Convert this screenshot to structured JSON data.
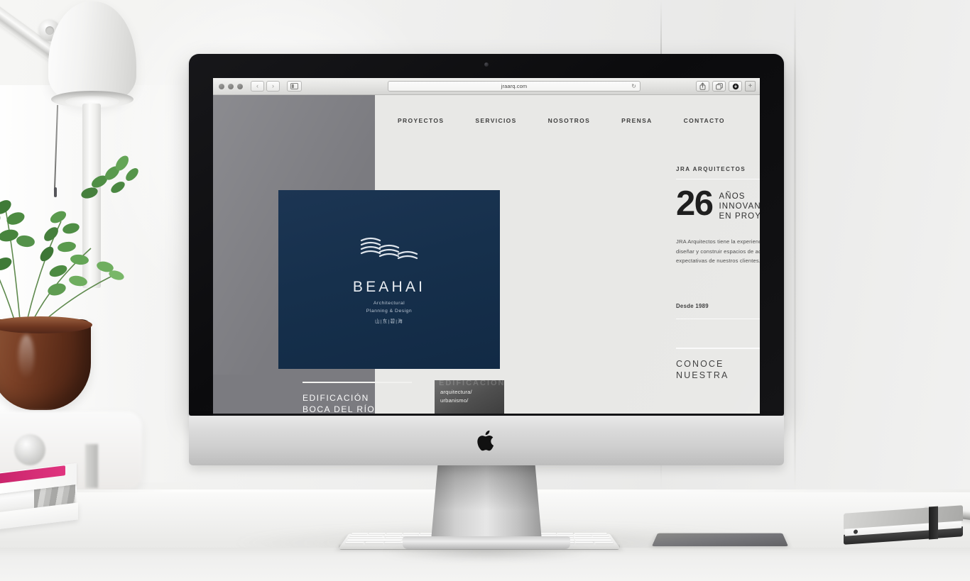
{
  "scene": {
    "description": "Desktop workspace with iMac displaying a website",
    "objects": {
      "lamp": "desk-lamp",
      "plant": "potted-plant",
      "books": "stacked-magazines",
      "notebook": "notebook",
      "pen": "pen",
      "keyboard": "apple-magic-keyboard",
      "trackpad": "apple-magic-trackpad"
    }
  },
  "browser": {
    "traffic_lights": [
      "close",
      "minimize",
      "zoom"
    ],
    "back_label": "‹",
    "forward_label": "›",
    "sidebar_icon": "sidebar-icon",
    "url": "jraarq.com",
    "reload_label": "↻",
    "tools": [
      {
        "name": "share-icon",
        "glyph": "⇧"
      },
      {
        "name": "tabs-icon",
        "glyph": "⧉"
      },
      {
        "name": "downloads-icon",
        "glyph": "●"
      }
    ],
    "new_tab_label": "+"
  },
  "site": {
    "nav": [
      {
        "label": "PROYECTOS",
        "name": "nav-proyectos"
      },
      {
        "label": "SERVICIOS",
        "name": "nav-servicios"
      },
      {
        "label": "NOSOTROS",
        "name": "nav-nosotros"
      },
      {
        "label": "PRENSA",
        "name": "nav-prensa"
      },
      {
        "label": "CONTACTO",
        "name": "nav-contacto"
      }
    ],
    "hero": {
      "brand": "BEAHAI",
      "tagline_line1": "Architectural",
      "tagline_line2": "Planning & Design",
      "chinese": "山|东|碧|海",
      "panel_color": "#16304c"
    },
    "content": {
      "kicker": "JRA ARQUITECTOS",
      "big_number": "26",
      "big_text_line1": "AÑOS",
      "big_text_line2": "INNOVANDO",
      "big_text_line3": "EN PROYECTOS",
      "paragraph": "JRA Arquitectos tiene la experiencia y el conocimiento de para diseñar y construir espacios de acuerdo a las necesidades y expectativas de nuestros clientes.",
      "since": "Desde 1989",
      "cta_line1": "CONOCE",
      "cta_line2": "NUESTRA"
    },
    "footer": {
      "project_title_line1": "EDIFICACIÓN",
      "project_title_line2": "BOCA DEL RÍO",
      "thumb_line1": "arquitectura/",
      "thumb_line2": "urbanismo/"
    },
    "colors": {
      "sidebar_gray": "#7b7b80",
      "page_bg": "#e8e8e6",
      "navy": "#16304c",
      "ink": "#1d1d1d"
    }
  }
}
